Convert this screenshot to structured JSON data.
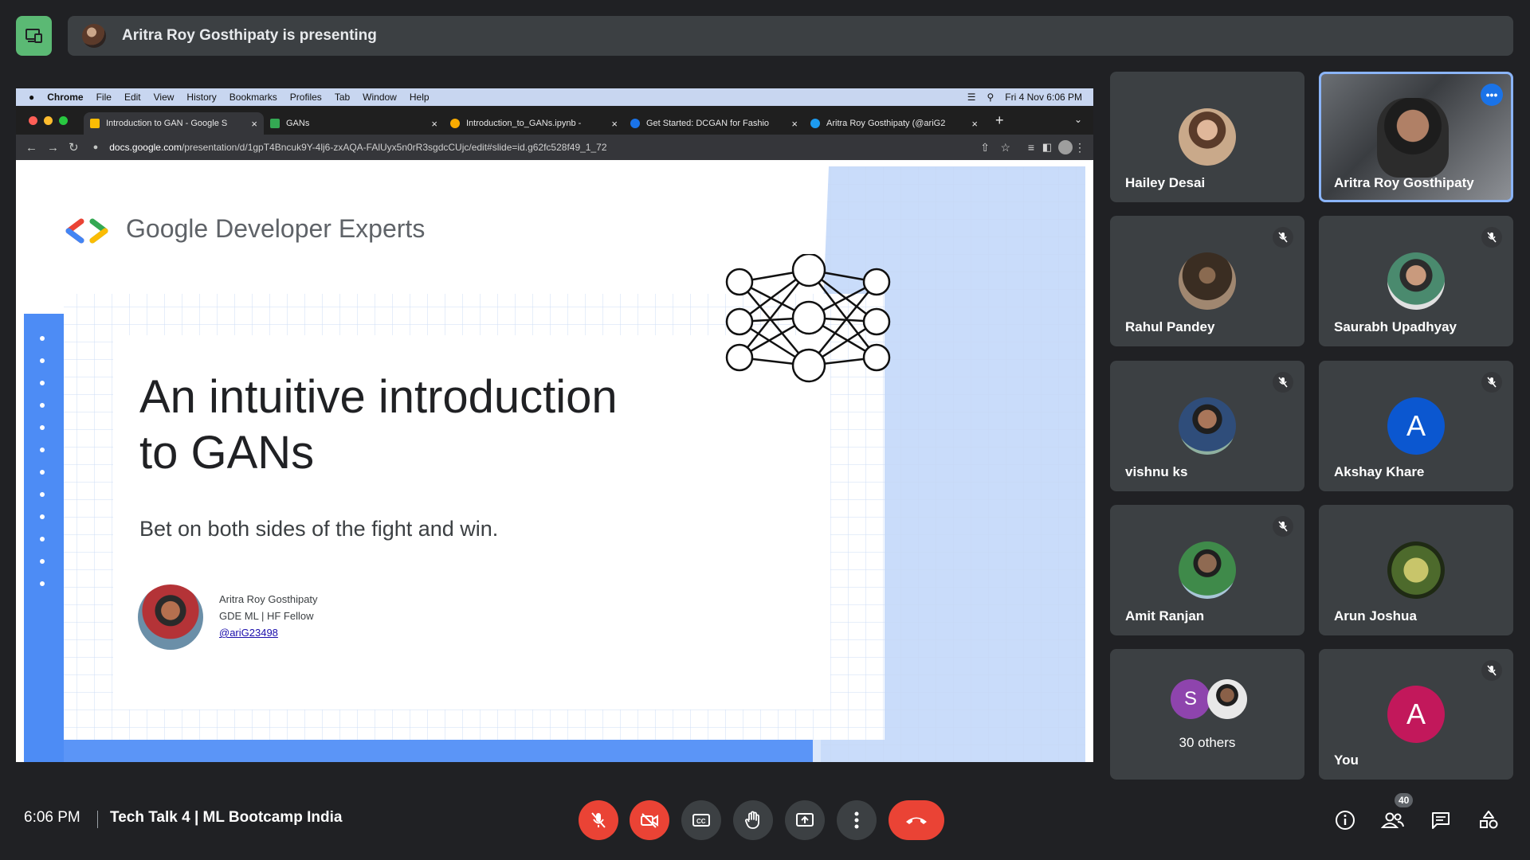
{
  "banner": {
    "presenting_text": "Aritra Roy Gosthipaty is presenting"
  },
  "browser": {
    "menubar": {
      "items": [
        "Chrome",
        "File",
        "Edit",
        "View",
        "History",
        "Bookmarks",
        "Profiles",
        "Tab",
        "Window",
        "Help"
      ],
      "datetime": "Fri 4 Nov  6:06 PM"
    },
    "tabs": [
      {
        "label": "Introduction to GAN - Google S",
        "color": "#fbbc04"
      },
      {
        "label": "GANs",
        "color": "#34a853"
      },
      {
        "label": "Introduction_to_GANs.ipynb -",
        "color": "#f9ab00"
      },
      {
        "label": "Get Started: DCGAN for Fashio",
        "color": "#1a73e8"
      },
      {
        "label": "Aritra Roy Gosthipaty (@ariG2",
        "color": "#1d9bf0"
      }
    ],
    "url_domain": "docs.google.com",
    "url_path": "/presentation/d/1gpT4Bncuk9Y-4lj6-zxAQA-FAlUyx5n0rR3sgdcCUjc/edit#slide=id.g62fc528f49_1_72"
  },
  "slide": {
    "brand": "Google Developer Experts",
    "title_line1": "An intuitive introduction",
    "title_line2": "to GANs",
    "subtitle": "Bet on both sides of the fight and win.",
    "author_name": "Aritra Roy Gosthipaty",
    "author_role": "GDE ML | HF Fellow",
    "author_handle": "@ariG23498"
  },
  "participants": [
    {
      "name": "Hailey Desai",
      "muted": false
    },
    {
      "name": "Aritra Roy Gosthipaty",
      "muted": false,
      "active_speaker": true
    },
    {
      "name": "Rahul Pandey",
      "muted": true
    },
    {
      "name": "Saurabh Upadhyay",
      "muted": true
    },
    {
      "name": "vishnu ks",
      "muted": true
    },
    {
      "name": "Akshay Khare",
      "muted": true,
      "initial": "A",
      "color": "#0b57d0"
    },
    {
      "name": "Amit Ranjan",
      "muted": true
    },
    {
      "name": "Arun Joshua",
      "muted": false
    },
    {
      "name": "30 others",
      "initial": "S",
      "color": "#8e44ad"
    },
    {
      "name": "You",
      "muted": true,
      "initial": "A",
      "color": "#c2185b"
    }
  ],
  "bottom": {
    "time": "6:06 PM",
    "meeting_title": "Tech Talk 4 | ML Bootcamp India",
    "people_count": "40"
  },
  "colors": {
    "accent_red": "#ea4335",
    "active_border": "#8ab4f8",
    "present_chip": "#5bb974"
  }
}
